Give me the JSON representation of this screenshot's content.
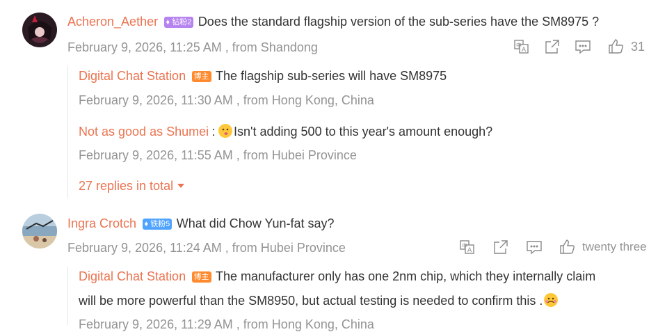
{
  "comments": [
    {
      "author": "Acheron_Aether",
      "badge": "钻粉2",
      "text": "Does the standard flagship version of the sub-series have the SM8975 ?",
      "time": "February 9, 2026, 11:25 AM , from Shandong",
      "likes": "31",
      "replies": [
        {
          "author": "Digital Chat Station",
          "badge": "博主",
          "text": "The flagship sub-series will have SM8975",
          "time": "February 9, 2026, 11:30 AM , from Hong Kong, China"
        },
        {
          "author": "Not as good as Shumei",
          "sep": ":",
          "text": "Isn't adding 500 to this year's amount enough?",
          "time": "February 9, 2026, 11:55 AM , from Hubei Province"
        }
      ],
      "more_replies": "27 replies in total"
    },
    {
      "author": "Ingra Crotch",
      "badge": "铁粉5",
      "text": "What did Chow Yun-fat say?",
      "time": "February 9, 2026, 11:24 AM , from Hubei Province",
      "likes": "twenty three",
      "replies": [
        {
          "author": "Digital Chat Station",
          "badge": "博主",
          "text_line1": "The manufacturer only has one 2nm chip, which they internally claim",
          "text_line2": "will be more powerful than the SM8950, but actual testing is needed to confirm this .",
          "time": "February 9, 2026, 11:29 AM , from Hong Kong, China"
        }
      ]
    }
  ],
  "icons": {
    "translate": "translate-icon",
    "share": "share-icon",
    "comment": "comment-icon",
    "like": "thumbs-up-icon",
    "caret": "caret-down-icon"
  },
  "colors": {
    "name": "#eb7350",
    "meta": "#939393",
    "text": "#333333",
    "badge_purple": "#b683f0",
    "badge_blue": "#4fa3ff",
    "badge_orange": "#ff8a2e"
  }
}
